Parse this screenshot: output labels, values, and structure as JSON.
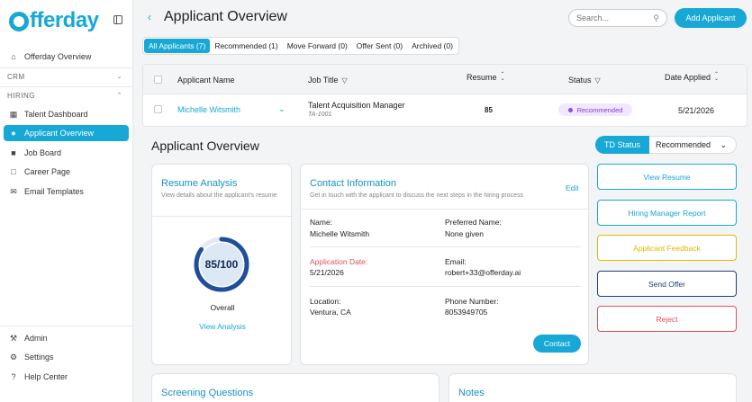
{
  "brand": {
    "name": "fferday",
    "color": "#17a8d6"
  },
  "sidebar": {
    "items_top": [
      {
        "label": "Offerday Overview",
        "icon": "home-icon"
      }
    ],
    "crm_label": "CRM",
    "hiring_label": "HIRING",
    "hiring_items": [
      {
        "label": "Talent Dashboard",
        "icon": "dashboard-icon"
      },
      {
        "label": "Applicant Overview",
        "icon": "users-icon",
        "active": true
      },
      {
        "label": "Job Board",
        "icon": "briefcase-icon"
      },
      {
        "label": "Career Page",
        "icon": "page-icon"
      },
      {
        "label": "Email Templates",
        "icon": "email-icon"
      }
    ],
    "bottom_items": [
      {
        "label": "Admin",
        "icon": "wrench-icon"
      },
      {
        "label": "Settings",
        "icon": "gear-icon"
      },
      {
        "label": "Help Center",
        "icon": "help-icon"
      }
    ]
  },
  "header": {
    "title": "Applicant Overview",
    "search_placeholder": "Search...",
    "add_button": "Add Applicant"
  },
  "tabs": [
    {
      "label": "All Applicants (7)",
      "active": true
    },
    {
      "label": "Recommended (1)"
    },
    {
      "label": "Move Forward (0)"
    },
    {
      "label": "Offer Sent (0)"
    },
    {
      "label": "Archived (0)"
    }
  ],
  "table": {
    "columns": [
      "Applicant Name",
      "Job Title",
      "Resume",
      "Status",
      "Date Applied"
    ],
    "row": {
      "name": "Michelle Witsmith",
      "job_title": "Talent Acquisition Manager",
      "job_code": "TA-1001",
      "resume": "85",
      "status": "Recommended",
      "date": "5/21/2026"
    }
  },
  "detail": {
    "title": "Applicant Overview",
    "td_status_label": "TD Status",
    "td_status_value": "Recommended"
  },
  "resume_analysis": {
    "title": "Resume Analysis",
    "subtitle": "View details about the applicant's resume",
    "score_text": "85/100",
    "score_value": 85,
    "overall": "Overall",
    "link": "View Analysis"
  },
  "contact": {
    "title": "Contact Information",
    "subtitle": "Get in touch with the applicant to discuss the next steps in the hiring process",
    "edit": "Edit",
    "name_label": "Name:",
    "name": "Michelle Witsmith",
    "preferred_label": "Preferred Name:",
    "preferred": "None given",
    "app_date_label": "Application Date:",
    "app_date": "5/21/2026",
    "email_label": "Email:",
    "email": "robert+33@offerday.ai",
    "location_label": "Location:",
    "location": "Ventura, CA",
    "phone_label": "Phone Number:",
    "phone": "8053949705",
    "button": "Contact"
  },
  "actions": [
    {
      "label": "View Resume",
      "color": "#17a8d6"
    },
    {
      "label": "Hiring Manager Report",
      "color": "#17a8d6"
    },
    {
      "label": "Applicant Feedback",
      "color": "#e6b800"
    },
    {
      "label": "Send Offer",
      "color": "#1f3d7a"
    },
    {
      "label": "Reject",
      "color": "#e0505a"
    }
  ],
  "bottom_cards": {
    "screening": "Screening Questions",
    "notes": "Notes"
  }
}
